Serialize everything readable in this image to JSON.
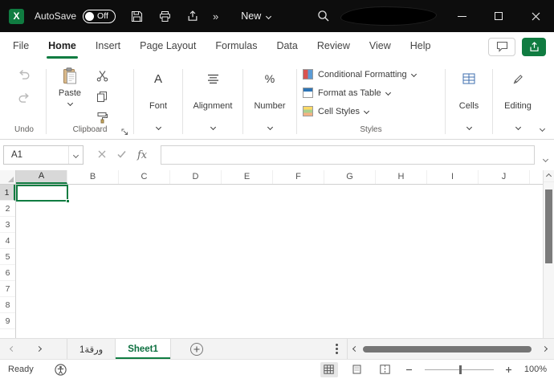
{
  "colors": {
    "accent_green": "#107C41"
  },
  "titlebar": {
    "autosave": {
      "label": "AutoSave",
      "state": "Off"
    },
    "qat_more": "»",
    "doc_title": "New"
  },
  "menubar": {
    "tabs": [
      "File",
      "Home",
      "Insert",
      "Page Layout",
      "Formulas",
      "Data",
      "Review",
      "View",
      "Help"
    ],
    "active_tab": "Home"
  },
  "ribbon": {
    "undo": {
      "label": "Undo"
    },
    "clipboard": {
      "label": "Clipboard",
      "paste_label": "Paste"
    },
    "font": {
      "label": "Font",
      "icon_glyph": "A"
    },
    "alignment": {
      "label": "Alignment"
    },
    "number": {
      "label": "Number",
      "icon_glyph": "%"
    },
    "styles": {
      "label": "Styles",
      "buttons": [
        "Conditional Formatting",
        "Format as Table",
        "Cell Styles"
      ]
    },
    "cells": {
      "label": "Cells"
    },
    "editing": {
      "label": "Editing"
    }
  },
  "formula_bar": {
    "name_box": "A1",
    "fx_label": "fx",
    "value": ""
  },
  "grid": {
    "columns": [
      "A",
      "B",
      "C",
      "D",
      "E",
      "F",
      "G",
      "H",
      "I",
      "J"
    ],
    "rows": [
      "1",
      "2",
      "3",
      "4",
      "5",
      "6",
      "7",
      "8",
      "9"
    ],
    "selected": "A1"
  },
  "sheetbar": {
    "tabs": [
      {
        "name": "ورقة1",
        "active": false
      },
      {
        "name": "Sheet1",
        "active": true
      }
    ]
  },
  "statusbar": {
    "status": "Ready",
    "zoom_level": "100%"
  }
}
